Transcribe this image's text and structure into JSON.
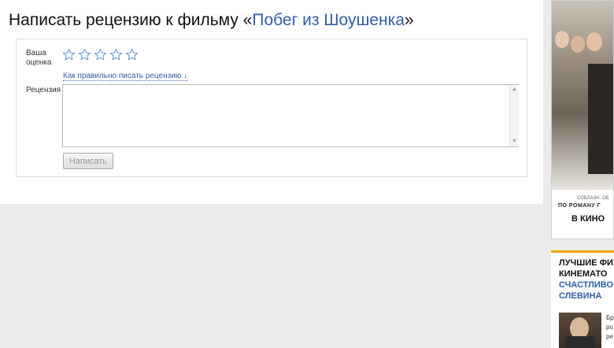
{
  "page": {
    "title_prefix": "Написать рецензию к фильму «",
    "film_link": "Побег из Шоушенка",
    "title_suffix": "»"
  },
  "form": {
    "rating_label": "Ваша оценка",
    "stars_count": 5,
    "rating_value": 0,
    "howto_link": "Как правильно писать рецензию ↓",
    "review_label": "Рецензия",
    "review_value": "",
    "submit_label": "Написать"
  },
  "ad": {
    "small_text": "СОБЛАЗН. ОБ",
    "novel_text": "ПО РОМАНУ Г",
    "cinema_text": "В КИНО"
  },
  "promo": {
    "line1": "ЛУЧШИЕ ФИ",
    "line2": "КИНЕМАТО",
    "line3": "СЧАСТЛИВО",
    "line4": "СЛЕВИНА",
    "snippet1": "Бр",
    "snippet2": "ро",
    "snippet3": "ре",
    "accent_color": "#f2a500"
  },
  "colors": {
    "link": "#2f5fa8",
    "star_outline": "#5f8fd0",
    "background": "#ececec"
  }
}
